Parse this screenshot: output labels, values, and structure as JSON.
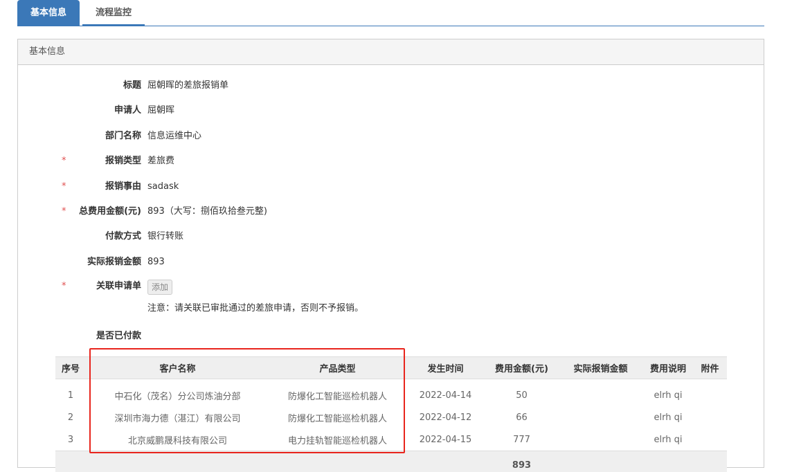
{
  "tabs": [
    {
      "label": "基本信息"
    },
    {
      "label": "流程监控"
    }
  ],
  "panel": {
    "title": "基本信息"
  },
  "form": [
    {
      "label": "标题",
      "value": "屈朝晖的差旅报销单",
      "required": false
    },
    {
      "label": "申请人",
      "value": "屈朝晖",
      "required": false
    },
    {
      "label": "部门名称",
      "value": "信息运维中心",
      "required": false
    },
    {
      "label": "报销类型",
      "value": "差旅费",
      "required": true
    },
    {
      "label": "报销事由",
      "value": "sadask",
      "required": true
    },
    {
      "label": "总费用金额(元)",
      "value": "893（大写：捌佰玖拾叁元整)",
      "required": true
    },
    {
      "label": "付款方式",
      "value": "银行转账",
      "required": false
    },
    {
      "label": "实际报销金额",
      "value": "893",
      "required": false
    }
  ],
  "related": {
    "label": "关联申请单",
    "star": "*",
    "add_label": "添加",
    "note": "注意：请关联已审批通过的差旅申请，否则不予报销。"
  },
  "paid": {
    "label": "是否已付款"
  },
  "star": "*",
  "table": {
    "headers": [
      "序号",
      "客户名称",
      "产品类型",
      "发生时间",
      "费用金额(元)",
      "实际报销金额",
      "费用说明",
      "附件"
    ],
    "rows": [
      [
        "1",
        "中石化（茂名）分公司炼油分部",
        "防爆化工智能巡检机器人",
        "2022-04-14",
        "50",
        "",
        "elrh qi",
        ""
      ],
      [
        "2",
        "深圳市海力德（湛江）有限公司",
        "防爆化工智能巡检机器人",
        "2022-04-12",
        "66",
        "",
        "elrh qi",
        ""
      ],
      [
        "3",
        "北京威鹏晟科技有限公司",
        "电力挂轨智能巡检机器人",
        "2022-04-15",
        "777",
        "",
        "elrh qi",
        ""
      ]
    ],
    "total": "893"
  }
}
